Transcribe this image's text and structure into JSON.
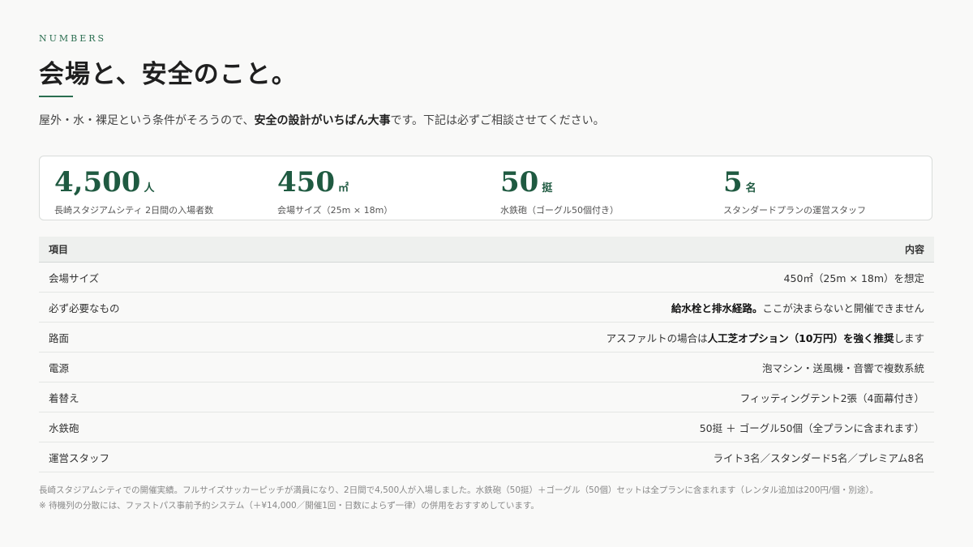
{
  "header": {
    "eyebrow": "NUMBERS",
    "title": "会場と、安全のこと。",
    "lead_pre": "屋外・水・裸足という条件がそろうので、",
    "lead_bold": "安全の設計がいちばん大事",
    "lead_post": "です。下記は必ずご相談させてください。"
  },
  "stats": [
    {
      "value": "4,500",
      "unit": "人",
      "label": "長崎スタジアムシティ 2日間の入場者数"
    },
    {
      "value": "450",
      "unit": "㎡",
      "label": "会場サイズ（25m × 18m）"
    },
    {
      "value": "50",
      "unit": "挺",
      "label": "水鉄砲（ゴーグル50個付き）"
    },
    {
      "value": "5",
      "unit": "名",
      "label": "スタンダードプランの運営スタッフ"
    }
  ],
  "table": {
    "col_item": "項目",
    "col_content": "内容",
    "rows": [
      {
        "item": "会場サイズ",
        "pre": "450㎡（25m × 18m）を想定",
        "bold": "",
        "post": ""
      },
      {
        "item": "必ず必要なもの",
        "pre": "",
        "bold": "給水栓と排水経路。",
        "post": "ここが決まらないと開催できません"
      },
      {
        "item": "路面",
        "pre": "アスファルトの場合は",
        "bold": "人工芝オプション（10万円）を強く推奨",
        "post": "します"
      },
      {
        "item": "電源",
        "pre": "泡マシン・送風機・音響で複数系統",
        "bold": "",
        "post": ""
      },
      {
        "item": "着替え",
        "pre": "フィッティングテント2張（4面幕付き）",
        "bold": "",
        "post": ""
      },
      {
        "item": "水鉄砲",
        "pre": "50挺 ＋ ゴーグル50個（全プランに含まれます）",
        "bold": "",
        "post": ""
      },
      {
        "item": "運営スタッフ",
        "pre": "ライト3名／スタンダード5名／プレミアム8名",
        "bold": "",
        "post": ""
      }
    ]
  },
  "notes": [
    "長崎スタジアムシティでの開催実績。フルサイズサッカーピッチが満員になり、2日間で4,500人が入場しました。水鉄砲（50挺）＋ゴーグル（50個）セットは全プランに含まれます（レンタル追加は200円/個・別途）。",
    "※ 待機列の分散には、ファストパス事前予約システム（＋¥14,000／開催1回・日数によらず一律）の併用をおすすめしています。"
  ]
}
